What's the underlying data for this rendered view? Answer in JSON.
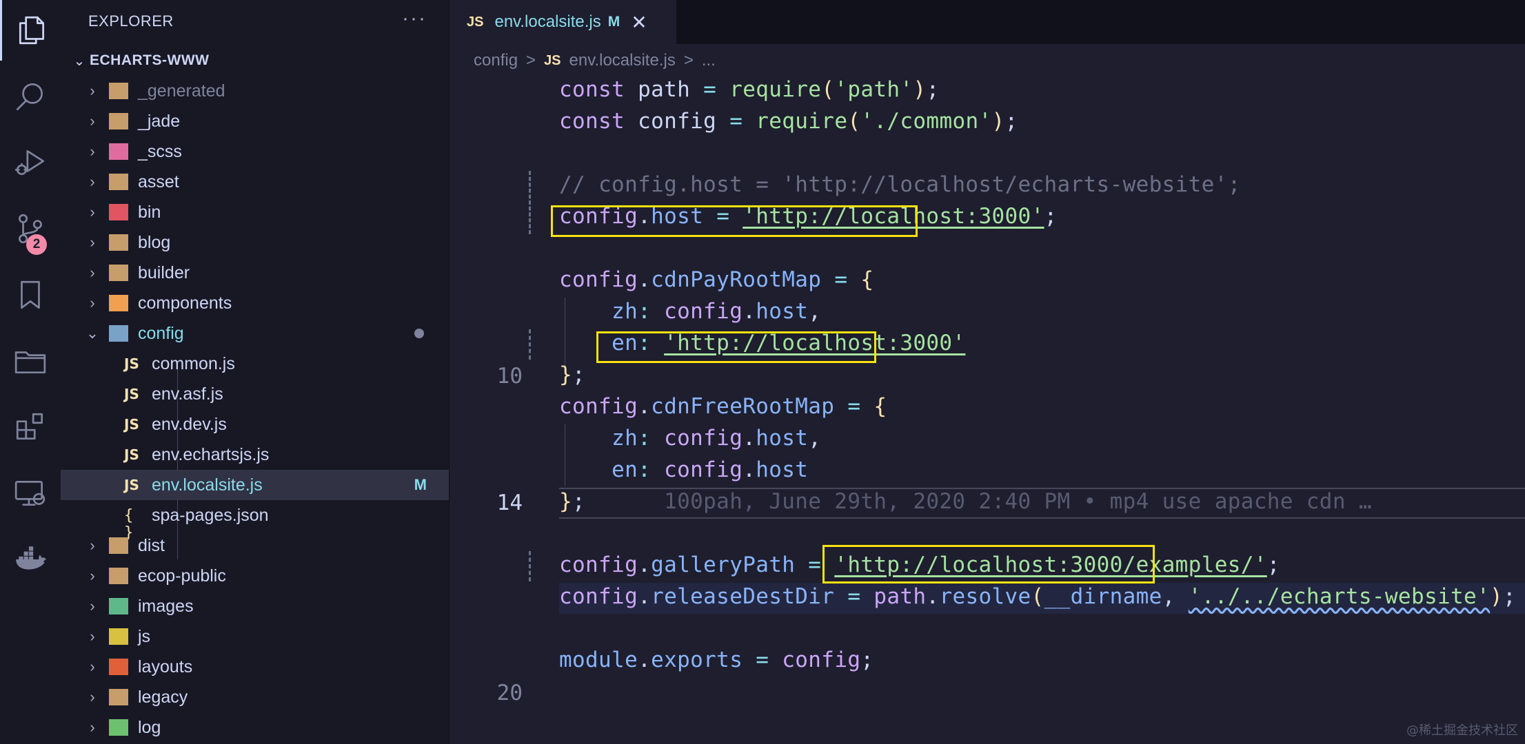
{
  "activity_bar": {
    "items": [
      {
        "icon": "files-icon",
        "active": true
      },
      {
        "icon": "search-icon"
      },
      {
        "icon": "run-debug-icon"
      },
      {
        "icon": "source-control-icon",
        "badge": "2"
      },
      {
        "icon": "bookmark-icon"
      },
      {
        "icon": "folder-icon"
      },
      {
        "icon": "extensions-icon"
      },
      {
        "icon": "remote-explorer-icon"
      },
      {
        "icon": "docker-icon"
      }
    ]
  },
  "explorer": {
    "title": "EXPLORER",
    "more": "···",
    "project": "ECHARTS-WWW",
    "items": [
      {
        "label": "_generated",
        "type": "folder",
        "color": "#c69d6b",
        "dim": true
      },
      {
        "label": "_jade",
        "type": "folder",
        "color": "#c69d6b"
      },
      {
        "label": "_scss",
        "type": "folder",
        "color": "#e06c9f"
      },
      {
        "label": "asset",
        "type": "folder",
        "color": "#c69d6b"
      },
      {
        "label": "bin",
        "type": "folder",
        "color": "#e05561"
      },
      {
        "label": "blog",
        "type": "folder",
        "color": "#c69d6b"
      },
      {
        "label": "builder",
        "type": "folder",
        "color": "#c69d6b"
      },
      {
        "label": "components",
        "type": "folder",
        "color": "#f0a050"
      },
      {
        "label": "config",
        "type": "folder-open",
        "color": "#7aa2c8",
        "modified_dot": true
      },
      {
        "label": "common.js",
        "type": "file",
        "icon": "JS"
      },
      {
        "label": "env.asf.js",
        "type": "file",
        "icon": "JS"
      },
      {
        "label": "env.dev.js",
        "type": "file",
        "icon": "JS"
      },
      {
        "label": "env.echartsjs.js",
        "type": "file",
        "icon": "JS"
      },
      {
        "label": "env.localsite.js",
        "type": "file",
        "icon": "JS",
        "selected": true,
        "status": "M"
      },
      {
        "label": "spa-pages.json",
        "type": "file",
        "icon": "{ }"
      },
      {
        "label": "dist",
        "type": "folder",
        "color": "#c69d6b"
      },
      {
        "label": "ecop-public",
        "type": "folder",
        "color": "#c69d6b"
      },
      {
        "label": "images",
        "type": "folder",
        "color": "#5fb88a"
      },
      {
        "label": "js",
        "type": "folder",
        "color": "#d8c040"
      },
      {
        "label": "layouts",
        "type": "folder",
        "color": "#e0603a"
      },
      {
        "label": "legacy",
        "type": "folder",
        "color": "#c69d6b"
      },
      {
        "label": "log",
        "type": "folder",
        "color": "#6cc070"
      }
    ]
  },
  "tab": {
    "icon": "JS",
    "name": "env.localsite.js",
    "status": "M",
    "close": "✕"
  },
  "breadcrumb": {
    "folder": "config",
    "sep": ">",
    "icon": "JS",
    "file": "env.localsite.js",
    "tail": "..."
  },
  "editor": {
    "line_numbers": {
      "l10": "10",
      "l14": "14",
      "l20": "20"
    },
    "blame": "100pah, June 29th, 2020 2:40 PM • mp4 use apache cdn …",
    "strings": {
      "path": "'path'",
      "common": "'./common'",
      "comment": "// config.host = 'http://localhost/echarts-website';",
      "host": "'http://localhost:3000'",
      "en": "'http://localhost:3000'",
      "gallery": "'http://localhost:3000/examples/'",
      "dest": "'../../echarts-website'"
    }
  },
  "watermark": "@稀土掘金技术社区"
}
